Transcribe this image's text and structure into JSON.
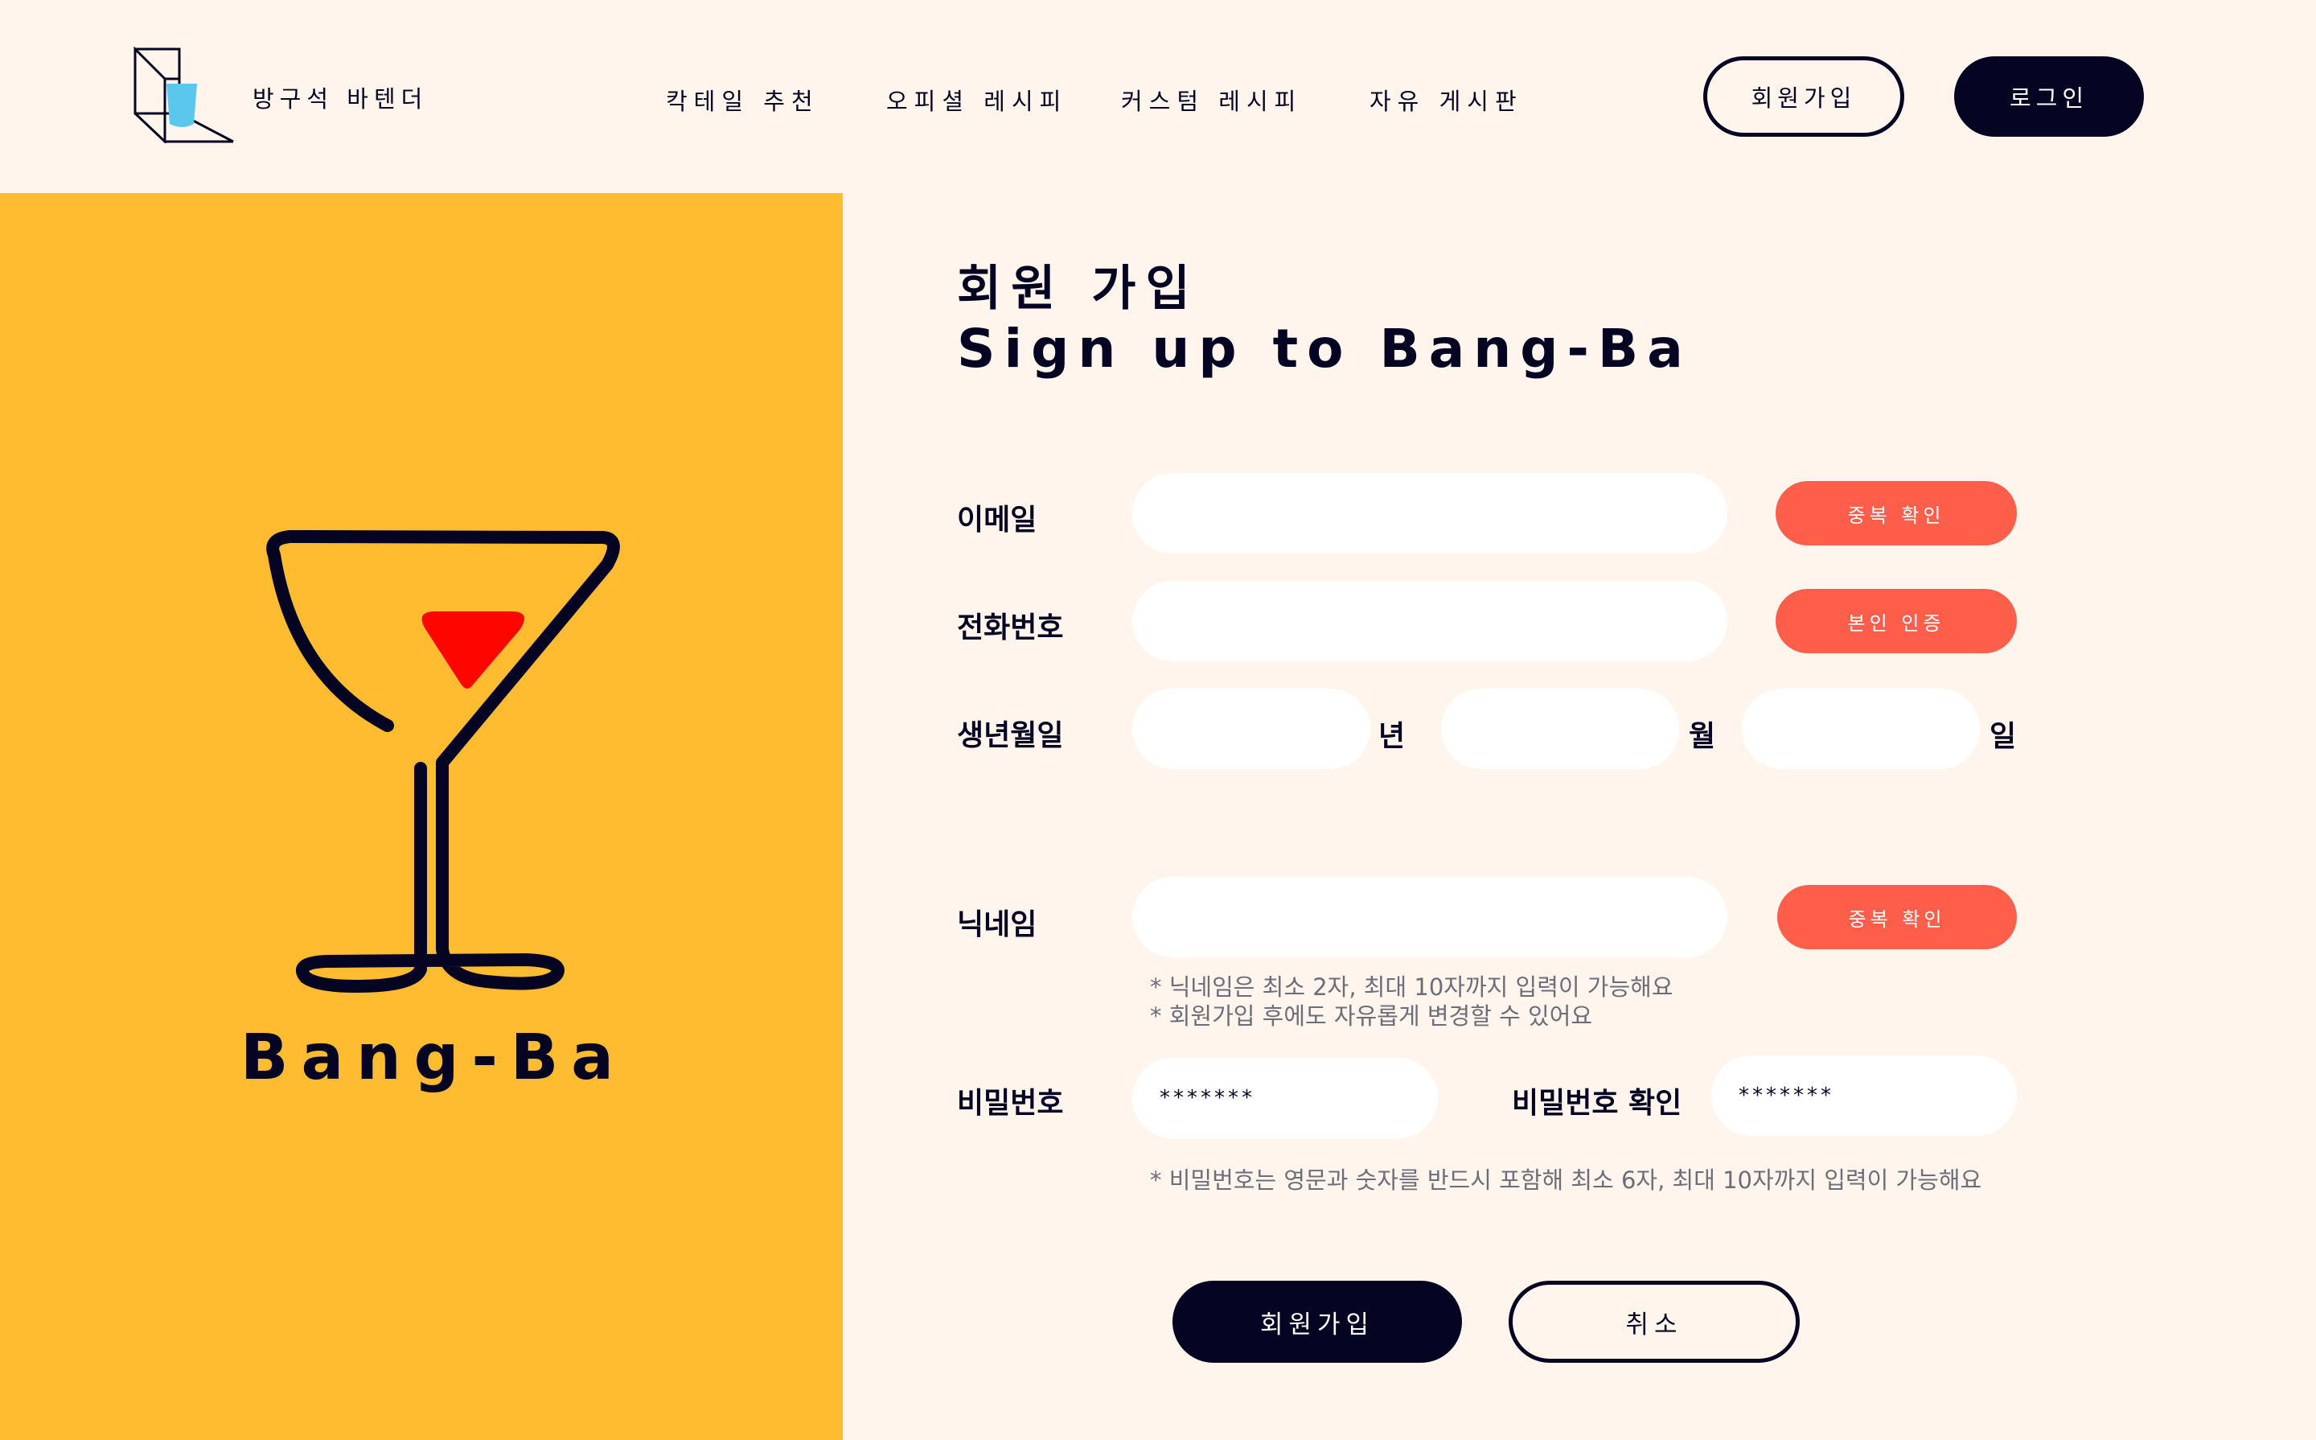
{
  "header": {
    "brand_name": "방구석 바텐더",
    "nav": [
      "칵테일 추천",
      "오피셜 레시피",
      "커스텀 레시피",
      "자유 게시판"
    ],
    "signup_label": "회원가입",
    "login_label": "로그인"
  },
  "hero": {
    "wordmark": "Bang-Ba"
  },
  "form": {
    "title_ko": "회원 가입",
    "title_en": "Sign up to Bang-Ba",
    "email_label": "이메일",
    "email_check_label": "중복 확인",
    "phone_label": "전화번호",
    "phone_verify_label": "본인 인증",
    "birth_label": "생년월일",
    "birth_year_unit": "년",
    "birth_month_unit": "월",
    "birth_day_unit": "일",
    "nickname_label": "닉네임",
    "nickname_check_label": "중복 확인",
    "nickname_hint_1": "* 닉네임은 최소 2자, 최대 10자까지 입력이 가능해요",
    "nickname_hint_2": "* 회원가입 후에도 자유롭게 변경할 수 있어요",
    "password_label": "비밀번호",
    "password_value": "*******",
    "password_confirm_label": "비밀번호 확인",
    "password_confirm_value": "*******",
    "password_hint": "* 비밀번호는 영문과 숫자를 반드시 포함해 최소 6자, 최대 10자까지 입력이 가능해요",
    "submit_label": "회원가입",
    "cancel_label": "취소"
  },
  "colors": {
    "background": "#FFF5EC",
    "navy": "#050523",
    "yellow": "#FFBC30",
    "coral": "#FF5E4B",
    "cocktail_red": "#FF0500",
    "logo_cup": "#5BC7EC"
  },
  "icons": {
    "logo": "glass-cube-logo-icon",
    "hero": "cocktail-glass-icon"
  }
}
